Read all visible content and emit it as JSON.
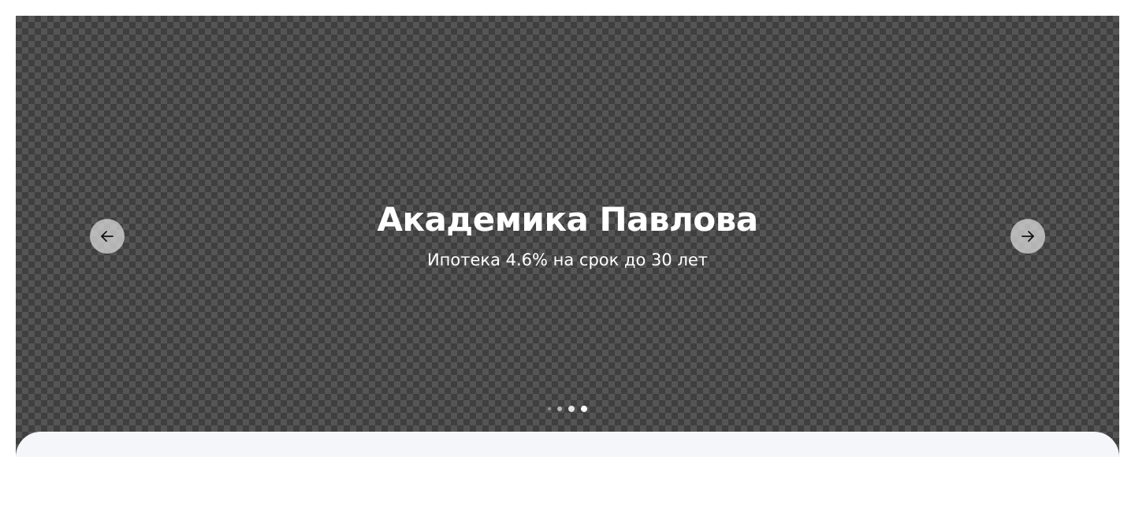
{
  "hero": {
    "title": "Академика Павлова",
    "subtitle": "Ипотека 4.6% на срок до 30 лет"
  },
  "carousel": {
    "prev_icon": "arrow-left-icon",
    "next_icon": "arrow-right-icon",
    "slides_count": 4,
    "active_index": 4
  },
  "colors": {
    "panel": "#f5f6fa",
    "arrow_bg": "#e1e1e1",
    "text": "#ffffff"
  }
}
